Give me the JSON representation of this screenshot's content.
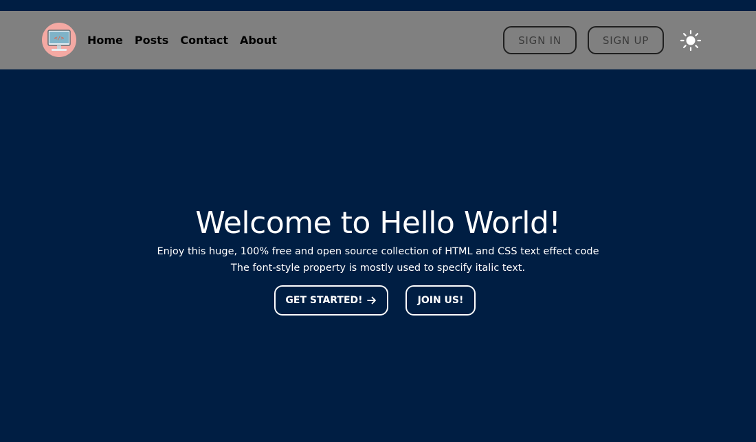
{
  "nav": {
    "logo_icon": "computer-code-logo-icon",
    "links": [
      {
        "label": "Home"
      },
      {
        "label": "Posts"
      },
      {
        "label": "Contact"
      },
      {
        "label": "About"
      }
    ],
    "sign_in_label": "SIGN IN",
    "sign_up_label": "SIGN UP",
    "theme_icon": "sun-icon"
  },
  "hero": {
    "title": "Welcome to Hello World!",
    "subtitle_line1": "Enjoy this huge, 100% free and open source collection of HTML and CSS text effect code",
    "subtitle_line2": "The font-style property is mostly used to specify italic text.",
    "get_started_label": "GET STARTED!",
    "join_label": "JOIN US!",
    "arrow_icon": "arrow-right-icon"
  },
  "colors": {
    "background": "#001e43",
    "navbar": "#808080",
    "logo_bg": "#f4a9a3",
    "text_light": "#ffffff",
    "nav_text": "#000000"
  }
}
